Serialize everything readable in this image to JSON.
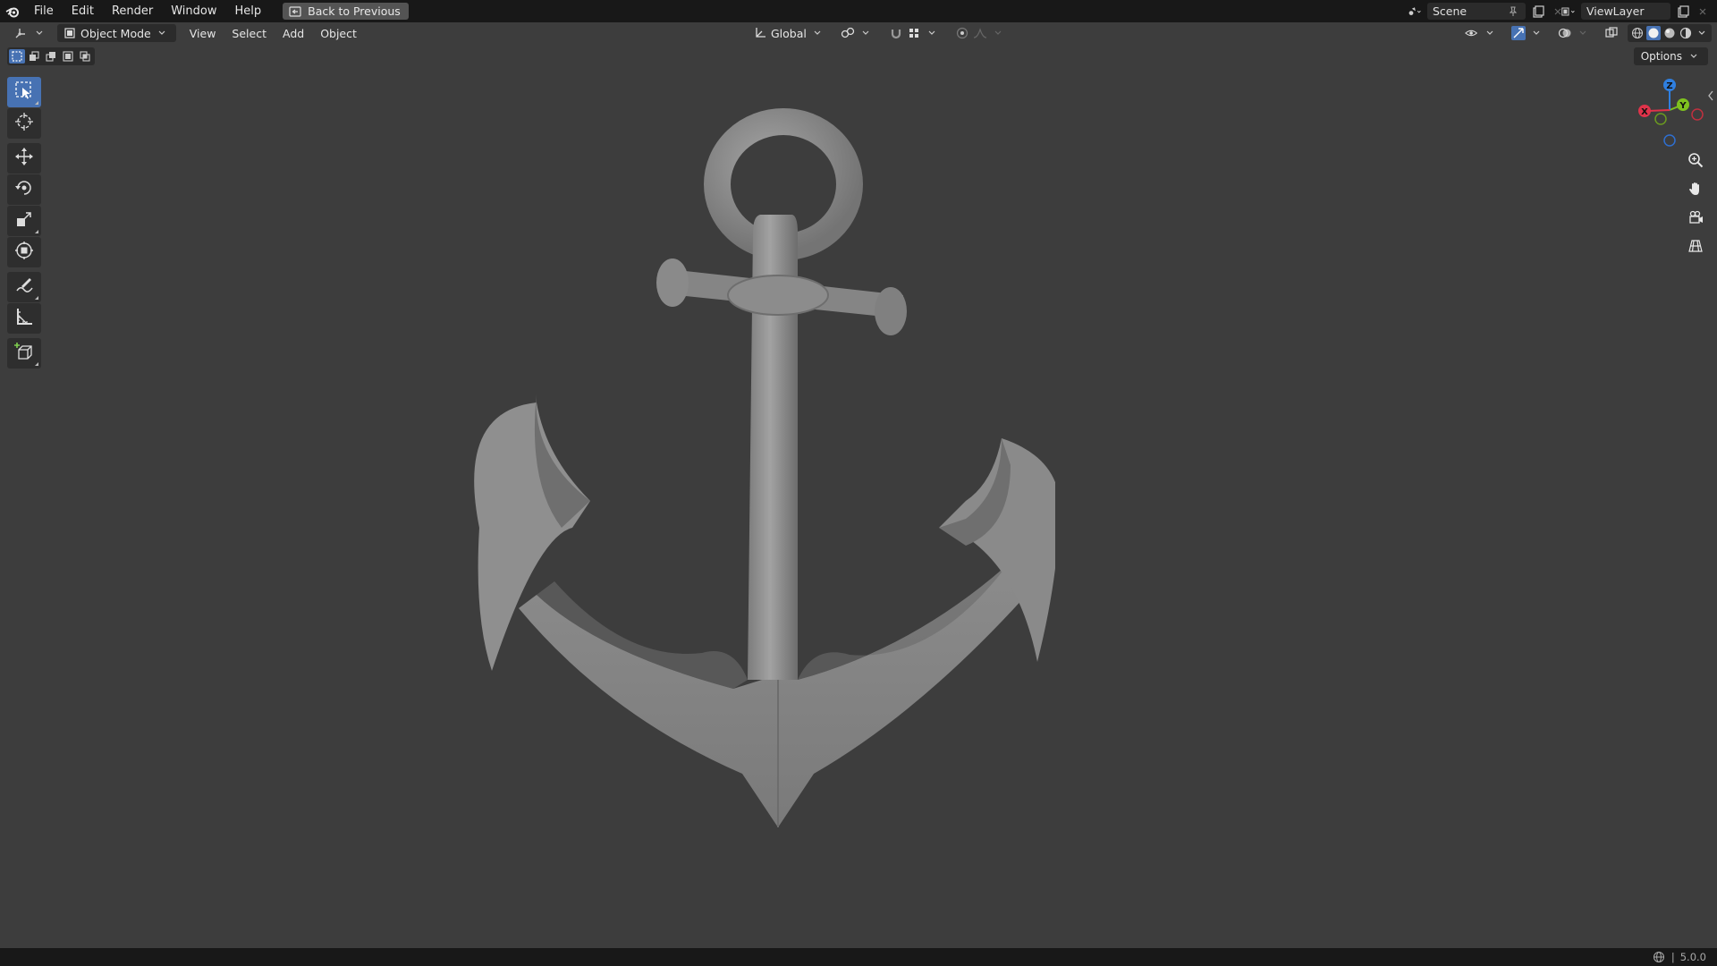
{
  "menubar": {
    "items": [
      "File",
      "Edit",
      "Render",
      "Window",
      "Help"
    ],
    "back_button": "Back to Previous",
    "scene": "Scene",
    "view_layer": "ViewLayer"
  },
  "header": {
    "mode": "Object Mode",
    "menus": [
      "View",
      "Select",
      "Add",
      "Object"
    ],
    "orientation": "Global",
    "options_label": "Options"
  },
  "toolbar": {
    "tools": [
      "select-box",
      "cursor",
      "move",
      "rotate",
      "scale",
      "transform",
      "annotate",
      "measure",
      "add-cube"
    ],
    "active": "select-box"
  },
  "gizmo": {
    "axes": [
      "X",
      "Y",
      "Z"
    ]
  },
  "status": {
    "version": "5.0.0"
  },
  "colors": {
    "accent": "#4772b3",
    "x_axis": "#e0334a",
    "y_axis": "#7fc21f",
    "z_axis": "#2f7fe0",
    "viewport_bg": "#3d3d3d",
    "object": "#8f8f8f"
  }
}
